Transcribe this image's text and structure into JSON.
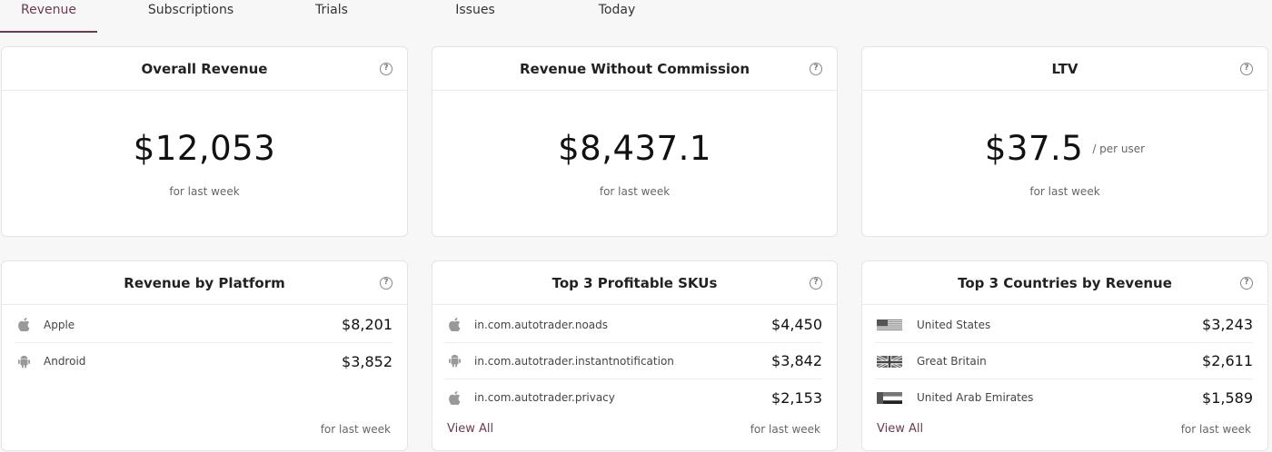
{
  "tabs": [
    "Revenue",
    "Subscriptions",
    "Trials",
    "Issues",
    "Today"
  ],
  "active_tab": "Revenue",
  "accent_color": "#6b3a52",
  "help_glyph": "?",
  "kpis": [
    {
      "title": "Overall Revenue",
      "value": "$12,053",
      "period": "for last week"
    },
    {
      "title": "Revenue Without Commission",
      "value": "$8,437.1",
      "period": "for last week"
    },
    {
      "title": "LTV",
      "value": "$37.5",
      "suffix": "/ per user",
      "period": "for last week"
    }
  ],
  "platform": {
    "title": "Revenue by Platform",
    "rows": [
      {
        "icon": "apple-icon",
        "label": "Apple",
        "value": "$8,201"
      },
      {
        "icon": "android-icon",
        "label": "Android",
        "value": "$3,852"
      }
    ],
    "period": "for last week"
  },
  "skus": {
    "title": "Top 3 Profitable SKUs",
    "rows": [
      {
        "icon": "apple-icon",
        "label": "in.com.autotrader.noads",
        "value": "$4,450"
      },
      {
        "icon": "android-icon",
        "label": "in.com.autotrader.instantnotification",
        "value": "$3,842"
      },
      {
        "icon": "apple-icon",
        "label": "in.com.autotrader.privacy",
        "value": "$2,153"
      }
    ],
    "view_all": "View All",
    "period": "for last week"
  },
  "countries": {
    "title": "Top 3 Countries by Revenue",
    "rows": [
      {
        "icon": "us-flag-icon",
        "label": "United States",
        "value": "$3,243"
      },
      {
        "icon": "gb-flag-icon",
        "label": "Great Britain",
        "value": "$2,611"
      },
      {
        "icon": "ae-flag-icon",
        "label": "United Arab Emirates",
        "value": "$1,589"
      }
    ],
    "view_all": "View All",
    "period": "for last week"
  }
}
